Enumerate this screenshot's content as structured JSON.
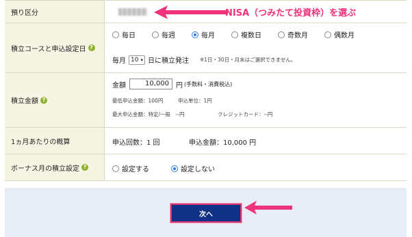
{
  "annotation": {
    "text": "NISA（つみたて投資枠）を選ぶ",
    "color": "#f0337a"
  },
  "rows": {
    "account": {
      "label": "預り区分"
    },
    "course": {
      "label": "積立コースと申込設定日",
      "options": [
        "毎日",
        "毎週",
        "毎月",
        "複数日",
        "奇数月",
        "偶数月"
      ],
      "selected": "毎月",
      "day_prefix": "毎月",
      "day_value": "10",
      "day_suffix": "日に積立発注",
      "day_note": "※1日・30日・月末はご選択できません。"
    },
    "amount": {
      "label": "積立金額",
      "prefix": "金額",
      "value": "10,000",
      "unit": "円",
      "unit_note": "(手数料・消費税込)",
      "min_label": "最低申込金額：100円",
      "unit_label": "申込単位：1円",
      "max_label": "最大申込金額：特定/一般　--円",
      "credit_label": "クレジットカード：--円"
    },
    "estimate": {
      "label": "1ヵ月あたりの概算",
      "count_text": "申込回数：1 回",
      "amount_text": "申込金額：10,000 円"
    },
    "bonus": {
      "label": "ボーナス月の積立設定",
      "options": [
        "設定する",
        "設定しない"
      ],
      "selected": "設定しない"
    }
  },
  "submit": {
    "label": "次へ"
  },
  "colors": {
    "label_bg": "#f6f5e4",
    "accent_pink": "#f0337a",
    "button_bg": "#0f3186",
    "help_green": "#8cb22d",
    "radio_blue": "#2f7de1",
    "footer_bg": "#e7edf6"
  },
  "icons": {
    "help": "question-circle-icon",
    "arrow": "left-arrow-icon"
  }
}
